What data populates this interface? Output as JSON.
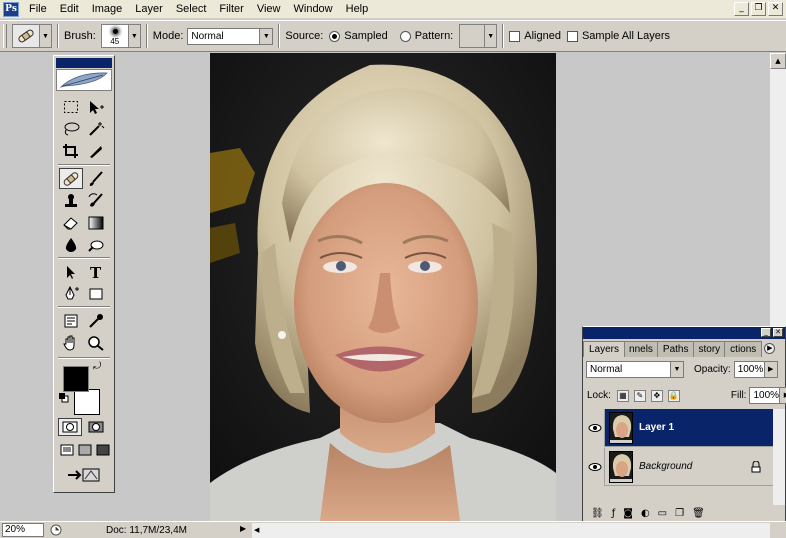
{
  "menu": {
    "app_icon": "Ps",
    "items": [
      "File",
      "Edit",
      "Image",
      "Layer",
      "Select",
      "Filter",
      "View",
      "Window",
      "Help"
    ]
  },
  "window_buttons": {
    "minimize": "_",
    "restore": "❐",
    "close": "✕"
  },
  "options": {
    "brush_label": "Brush:",
    "brush_size": "45",
    "mode_label": "Mode:",
    "mode_value": "Normal",
    "source_label": "Source:",
    "sampled_label": "Sampled",
    "pattern_label": "Pattern:",
    "aligned_label": "Aligned",
    "sample_all_layers_label": "Sample All Layers"
  },
  "status": {
    "zoom": "20%",
    "doc_info": "Doc: 11,7M/23,4M"
  },
  "layers_panel": {
    "tabs": [
      "Layers",
      "nnels",
      "Paths",
      "story",
      "ctions"
    ],
    "blend_mode": "Normal",
    "opacity_label": "Opacity:",
    "opacity_value": "100%",
    "lock_label": "Lock:",
    "fill_label": "Fill:",
    "fill_value": "100%",
    "layers": [
      {
        "name": "Layer 1",
        "selected": true
      },
      {
        "name": "Background",
        "selected": false,
        "locked": true
      }
    ]
  },
  "colors": {
    "selection": "#0a246a",
    "panel_bg": "#d4d0c8",
    "workspace": "#c8c8c8",
    "foreground": "#000000",
    "background": "#ffffff"
  },
  "icons": {
    "tools": [
      "marquee-icon",
      "move-icon",
      "lasso-icon",
      "magic-wand-icon",
      "crop-icon",
      "slice-icon",
      "healing-brush-icon",
      "brush-icon",
      "clone-stamp-icon",
      "history-brush-icon",
      "eraser-icon",
      "gradient-icon",
      "blur-icon",
      "dodge-icon",
      "path-select-icon",
      "type-icon",
      "pen-icon",
      "shape-icon",
      "notes-icon",
      "eyedropper-icon",
      "hand-icon",
      "zoom-icon"
    ]
  }
}
